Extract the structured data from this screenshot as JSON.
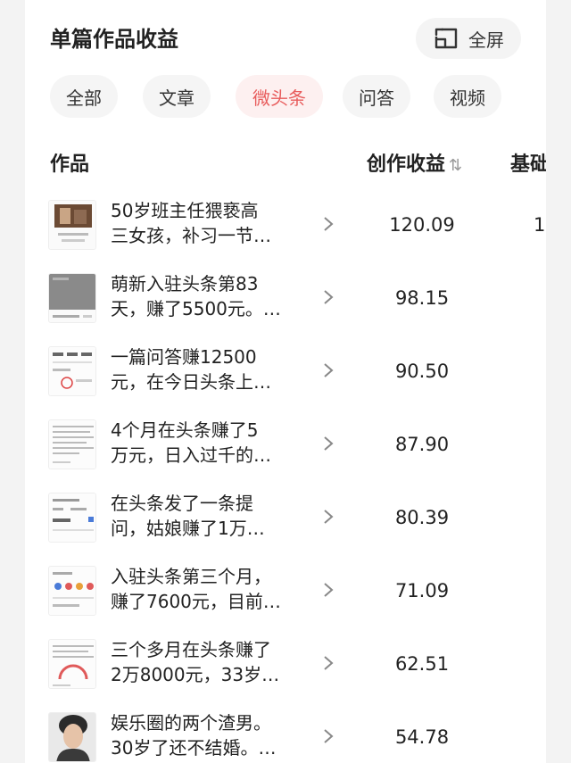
{
  "header": {
    "title": "单篇作品收益",
    "fullscreen_label": "全屏"
  },
  "tabs": [
    {
      "label": "全部",
      "active": false
    },
    {
      "label": "文章",
      "active": false
    },
    {
      "label": "微头条",
      "active": true
    },
    {
      "label": "问答",
      "active": false
    },
    {
      "label": "视频",
      "active": false
    }
  ],
  "table": {
    "columns": {
      "work": "作品",
      "income": "创作收益",
      "base": "基础"
    },
    "rows": [
      {
        "line1": "50岁班主任猥亵高",
        "line2": "三女孩，补习一节…",
        "income": "120.09",
        "base": "1",
        "thumb": "photo-thumbnail"
      },
      {
        "line1": "萌新入驻头条第83",
        "line2": "天，赚了5500元。…",
        "income": "98.15",
        "base": "",
        "thumb": "screenshot-thumbnail"
      },
      {
        "line1": "一篇问答赚12500",
        "line2": "元，在今日头条上…",
        "income": "90.50",
        "base": "",
        "thumb": "stats-thumbnail"
      },
      {
        "line1": "4个月在头条赚了5",
        "line2": "万元，日入过千的…",
        "income": "87.90",
        "base": "",
        "thumb": "text-thumbnail"
      },
      {
        "line1": "在头条发了一条提",
        "line2": "问，姑娘赚了1万…",
        "income": "80.39",
        "base": "",
        "thumb": "app-thumbnail"
      },
      {
        "line1": "入驻头条第三个月，",
        "line2": "赚了7600元，目前…",
        "income": "71.09",
        "base": "",
        "thumb": "icons-thumbnail"
      },
      {
        "line1": "三个多月在头条赚了",
        "line2": "2万8000元，33岁…",
        "income": "62.51",
        "base": "",
        "thumb": "gauge-thumbnail"
      },
      {
        "line1": "娱乐圈的两个渣男。",
        "line2": "30岁了还不结婚。…",
        "income": "54.78",
        "base": "",
        "thumb": "portrait-thumbnail"
      }
    ]
  },
  "colors": {
    "accent": "#e85c5c",
    "accent_bg": "#fdf0f0",
    "tab_bg": "#f5f5f5"
  }
}
